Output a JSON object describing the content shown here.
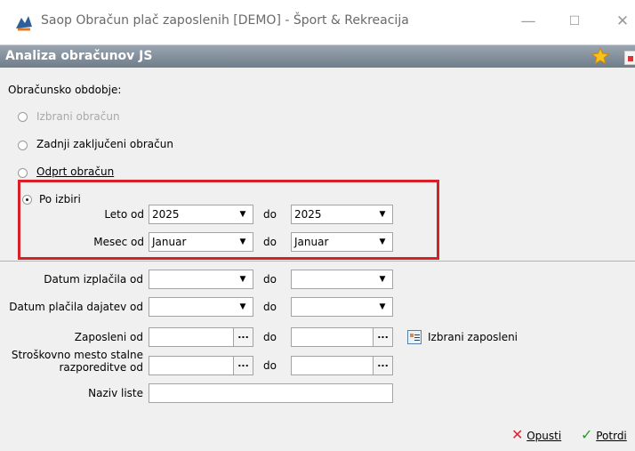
{
  "window": {
    "title": "Saop Obračun plač zaposlenih [DEMO] - Šport & Rekreacija",
    "minimize": "—",
    "maximize": "☐",
    "close": "✕"
  },
  "header": {
    "title": "Analiza obračunov JS"
  },
  "period": {
    "heading": "Obračunsko obdobje:",
    "options": [
      {
        "label": "Izbrani obračun",
        "selected": false,
        "enabled": false
      },
      {
        "label": "Zadnji zaključeni obračun",
        "selected": false,
        "enabled": true
      },
      {
        "label": "Odprt obračun",
        "selected": false,
        "enabled": true
      },
      {
        "label": "Po izbiri",
        "selected": true,
        "enabled": true
      }
    ],
    "leto_od_label": "Leto od",
    "leto_od_value": "2025",
    "leto_do_value": "2025",
    "mesec_od_label": "Mesec od",
    "mesec_od_value": "Januar",
    "mesec_do_value": "Januar",
    "do_label": "do"
  },
  "filters": {
    "datum_izplacila_label": "Datum izplačila od",
    "datum_placila_label": "Datum plačila dajatev od",
    "zaposleni_label": "Zaposleni od",
    "stroskovno_line1": "Stroškovno mesto stalne",
    "stroskovno_line2": "razporeditve od",
    "naziv_label": "Naziv liste",
    "naziv_value": "",
    "do_label": "do",
    "izbrani_label": "Izbrani zaposleni"
  },
  "footer": {
    "cancel_label": "Opusti",
    "confirm_label": "Potrdi"
  }
}
